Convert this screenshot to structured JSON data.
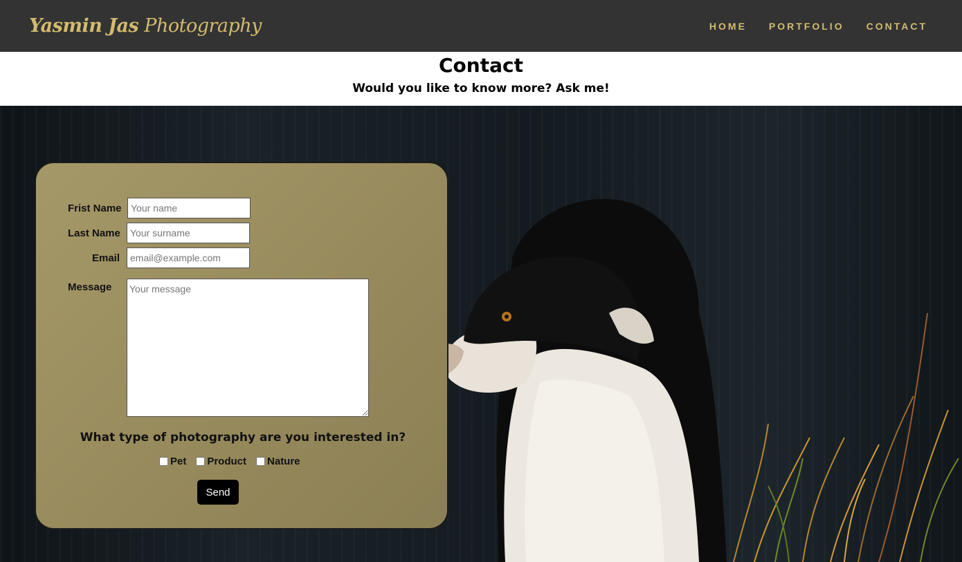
{
  "nav": {
    "brand_bold": "Yasmin Jas",
    "brand_rest": " Photography",
    "links": [
      "HOME",
      "PORTFOLIO",
      "CONTACT"
    ]
  },
  "header": {
    "title": "Contact",
    "subtitle": "Would you like to know more? Ask me!"
  },
  "form": {
    "first_name_label": "Frist Name",
    "first_name_placeholder": "Your name",
    "last_name_label": "Last Name",
    "last_name_placeholder": "Your surname",
    "email_label": "Email",
    "email_placeholder": "email@example.com",
    "message_label": "Message",
    "message_placeholder": "Your message",
    "question": "What type of photography are you interested in?",
    "options": [
      "Pet",
      "Product",
      "Nature"
    ],
    "send_label": "Send"
  },
  "colors": {
    "accent": "#d3bb6e",
    "navbar": "#333333",
    "form_bg": "#978a5c"
  }
}
